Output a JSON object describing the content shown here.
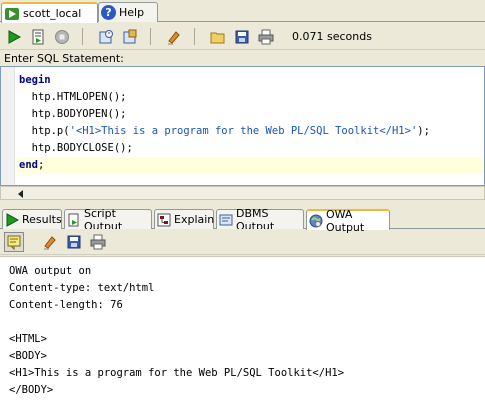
{
  "doc_tabs": [
    {
      "label": "scott_local",
      "icon": "database-icon",
      "active": true
    },
    {
      "label": "Help",
      "icon": "help-icon",
      "active": false
    }
  ],
  "toolbar": {
    "elapsed": "0.071 seconds",
    "buttons": [
      "run-statement-icon",
      "run-script-icon",
      "cancel-icon",
      "commit-icon",
      "rollback-icon",
      "clear-icon",
      "open-file-icon",
      "save-icon",
      "print-icon"
    ]
  },
  "sql_label": "Enter SQL Statement:",
  "editor": {
    "lines": [
      {
        "kw": "begin",
        "pre": "",
        "str": "",
        "post": ""
      },
      {
        "kw": "",
        "pre": "  htp.HTMLOPEN();",
        "str": "",
        "post": ""
      },
      {
        "kw": "",
        "pre": "  htp.BODYOPEN();",
        "str": "",
        "post": ""
      },
      {
        "kw": "",
        "pre": "  htp.p(",
        "str": "'<H1>This is a program for the Web PL/SQL Toolkit</H1>'",
        "post": ");"
      },
      {
        "kw": "",
        "pre": "  htp.BODYCLOSE();",
        "str": "",
        "post": ""
      },
      {
        "kw": "end",
        "pre": "",
        "str": "",
        "post": ";"
      }
    ]
  },
  "output_tabs": [
    {
      "label": "Results",
      "icon": "results-icon",
      "active": false
    },
    {
      "label": "Script Output",
      "icon": "script-output-icon",
      "active": false
    },
    {
      "label": "Explain",
      "icon": "explain-icon",
      "active": false
    },
    {
      "label": "DBMS Output",
      "icon": "dbms-output-icon",
      "active": false
    },
    {
      "label": "OWA Output",
      "icon": "owa-output-icon",
      "active": true
    }
  ],
  "output_toolbar": {
    "buttons": [
      "enable-owa-output-icon",
      "clear-icon",
      "save-icon",
      "print-icon"
    ]
  },
  "output": {
    "lines": [
      "OWA output on",
      "Content-type: text/html",
      "Content-length: 76",
      "",
      "<HTML>",
      "<BODY>",
      "<H1>This is a program for the Web PL/SQL Toolkit</H1>",
      "</BODY>"
    ]
  },
  "colors": {
    "keyword": "#00008b",
    "string": "#1a54b8",
    "current_line": "#ffffdc",
    "active_tab_accent": "#f0b83c"
  }
}
